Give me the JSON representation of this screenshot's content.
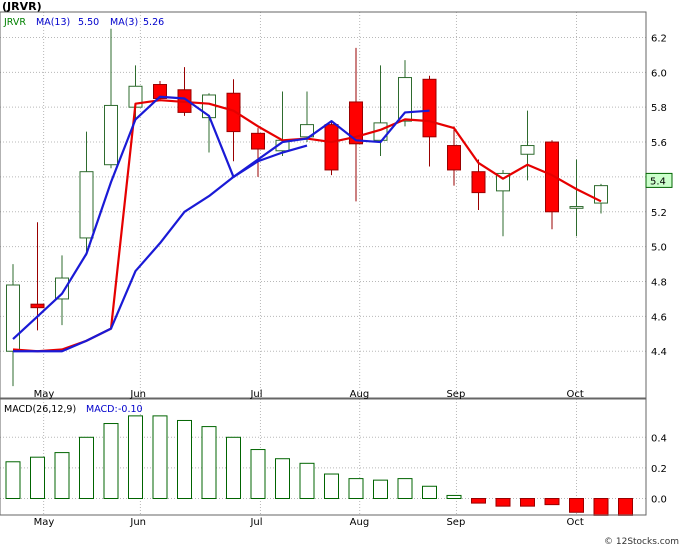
{
  "chart_data": [
    {
      "type": "candlestick",
      "title": "(JRVR)",
      "legend": [
        {
          "label": "JRVR",
          "value": "",
          "color": "#008000"
        },
        {
          "label": "MA(13)",
          "value": "5.50",
          "color": "#0000cc"
        },
        {
          "label": "MA(3)",
          "value": "5.26",
          "color": "#0000cc"
        }
      ],
      "yticks": [
        "4.4",
        "4.6",
        "4.8",
        "5.0",
        "5.2",
        "5.4",
        "5.6",
        "5.8",
        "6.0",
        "6.2"
      ],
      "ylim": [
        4.28,
        6.33
      ],
      "xticks": [
        {
          "label": "May",
          "index": 1.25
        },
        {
          "label": "Jun",
          "index": 5.2
        },
        {
          "label": "Jul",
          "index": 10.1
        },
        {
          "label": "Aug",
          "index": 14.15
        },
        {
          "label": "Sep",
          "index": 18.1
        },
        {
          "label": "Oct",
          "index": 23.0
        }
      ],
      "price_label": "5.4",
      "candles": [
        {
          "o": 4.4,
          "h": 4.9,
          "l": 4.2,
          "c": 4.78
        },
        {
          "o": 4.67,
          "h": 5.14,
          "l": 4.52,
          "c": 4.65
        },
        {
          "o": 4.7,
          "h": 4.95,
          "l": 4.55,
          "c": 4.82
        },
        {
          "o": 5.05,
          "h": 5.66,
          "l": 4.95,
          "c": 5.43
        },
        {
          "o": 5.47,
          "h": 6.25,
          "l": 5.45,
          "c": 5.81
        },
        {
          "o": 5.8,
          "h": 6.04,
          "l": 5.72,
          "c": 5.92
        },
        {
          "o": 5.93,
          "h": 5.95,
          "l": 5.84,
          "c": 5.85
        },
        {
          "o": 5.9,
          "h": 6.03,
          "l": 5.75,
          "c": 5.77
        },
        {
          "o": 5.74,
          "h": 5.88,
          "l": 5.54,
          "c": 5.87
        },
        {
          "o": 5.88,
          "h": 5.96,
          "l": 5.49,
          "c": 5.66
        },
        {
          "o": 5.65,
          "h": 5.68,
          "l": 5.4,
          "c": 5.56
        },
        {
          "o": 5.55,
          "h": 5.89,
          "l": 5.52,
          "c": 5.61
        },
        {
          "o": 5.63,
          "h": 5.89,
          "l": 5.6,
          "c": 5.7
        },
        {
          "o": 5.7,
          "h": 5.72,
          "l": 5.41,
          "c": 5.44
        },
        {
          "o": 5.83,
          "h": 6.14,
          "l": 5.26,
          "c": 5.59
        },
        {
          "o": 5.61,
          "h": 6.04,
          "l": 5.52,
          "c": 5.71
        },
        {
          "o": 5.72,
          "h": 6.07,
          "l": 5.69,
          "c": 5.97
        },
        {
          "o": 5.96,
          "h": 5.98,
          "l": 5.46,
          "c": 5.63
        },
        {
          "o": 5.58,
          "h": 5.69,
          "l": 5.35,
          "c": 5.44
        },
        {
          "o": 5.43,
          "h": 5.5,
          "l": 5.21,
          "c": 5.31
        },
        {
          "o": 5.32,
          "h": 5.44,
          "l": 5.06,
          "c": 5.42
        },
        {
          "o": 5.53,
          "h": 5.78,
          "l": 5.38,
          "c": 5.58
        },
        {
          "o": 5.6,
          "h": 5.61,
          "l": 5.1,
          "c": 5.2
        },
        {
          "o": 5.22,
          "h": 5.5,
          "l": 5.06,
          "c": 5.23
        },
        {
          "o": 5.25,
          "h": 5.36,
          "l": 5.19,
          "c": 5.35
        }
      ],
      "series": [
        {
          "name": "MA(3)",
          "color": "#e60000",
          "points": [
            [
              0.5,
              4.41
            ],
            [
              1.5,
              4.4
            ],
            [
              2.5,
              4.41
            ],
            [
              3.5,
              4.46
            ],
            [
              4.5,
              4.53
            ],
            [
              5.5,
              5.82
            ],
            [
              6.5,
              5.84
            ],
            [
              7.5,
              5.83
            ],
            [
              8.5,
              5.82
            ],
            [
              9.5,
              5.78
            ],
            [
              10.5,
              5.69
            ],
            [
              11.5,
              5.61
            ],
            [
              12.5,
              5.62
            ],
            [
              13.5,
              5.6
            ],
            [
              14.5,
              5.63
            ],
            [
              15.5,
              5.67
            ],
            [
              16.5,
              5.73
            ],
            [
              17.5,
              5.72
            ],
            [
              18.5,
              5.68
            ],
            [
              19.5,
              5.48
            ],
            [
              20.5,
              5.39
            ],
            [
              21.5,
              5.47
            ],
            [
              22.5,
              5.41
            ],
            [
              23.5,
              5.33
            ],
            [
              24.5,
              5.26
            ]
          ]
        },
        {
          "name": "MA(13)",
          "color": "#1a1ad6",
          "points": [
            [
              0.5,
              4.47
            ],
            [
              1.5,
              4.6
            ],
            [
              2.5,
              4.73
            ],
            [
              3.5,
              4.96
            ],
            [
              4.5,
              5.37
            ],
            [
              5.5,
              5.73
            ],
            [
              6.5,
              5.86
            ],
            [
              7.5,
              5.85
            ],
            [
              8.5,
              5.75
            ],
            [
              9.5,
              5.4
            ],
            [
              10.5,
              5.5
            ],
            [
              11.5,
              5.6
            ],
            [
              12.5,
              5.62
            ],
            [
              13.5,
              5.72
            ],
            [
              14.5,
              5.61
            ],
            [
              15.5,
              5.6
            ],
            [
              16.5,
              5.77
            ],
            [
              17.5,
              5.78
            ]
          ]
        },
        {
          "name": "MA(3)",
          "color": "#1a1ad6",
          "points": [
            [
              0.5,
              4.4
            ],
            [
              1.5,
              4.4
            ],
            [
              2.5,
              4.4
            ],
            [
              3.5,
              4.46
            ],
            [
              4.5,
              4.53
            ],
            [
              5.5,
              4.86
            ],
            [
              6.5,
              5.02
            ],
            [
              7.5,
              5.2
            ],
            [
              8.5,
              5.29
            ],
            [
              9.5,
              5.4
            ],
            [
              10.5,
              5.49
            ],
            [
              11.5,
              5.54
            ],
            [
              12.5,
              5.58
            ]
          ]
        }
      ]
    },
    {
      "type": "bar",
      "title": "MACD(26,12,9)",
      "legend": [
        {
          "label": "MACD(26,12,9)",
          "value": "",
          "color": "#000000"
        },
        {
          "label": "MACD:",
          "value": "-0.10",
          "color": "#0000cc"
        }
      ],
      "yticks": [
        "0.0",
        "0.2",
        "0.4"
      ],
      "ylim": [
        -0.12,
        0.55
      ],
      "values": [
        0.24,
        0.27,
        0.3,
        0.4,
        0.49,
        0.54,
        0.54,
        0.51,
        0.47,
        0.4,
        0.32,
        0.26,
        0.23,
        0.16,
        0.13,
        0.12,
        0.13,
        0.08,
        0.02,
        -0.03,
        -0.05,
        -0.05,
        -0.04,
        -0.09,
        -0.11,
        -0.11
      ]
    }
  ],
  "x_axis_labels": [
    "May",
    "Jun",
    "Jul",
    "Aug",
    "Sep",
    "Oct"
  ],
  "watermark": "© 12Stocks.com"
}
